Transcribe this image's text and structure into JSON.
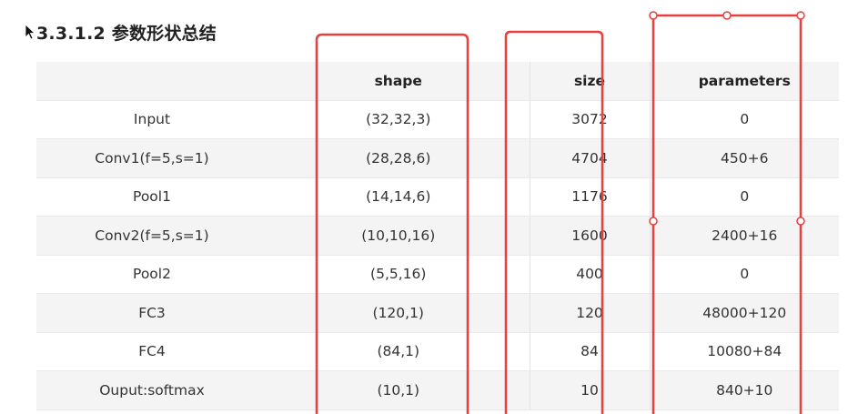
{
  "section": {
    "title": "3.3.1.2 参数形状总结"
  },
  "table": {
    "headers": [
      "",
      "shape",
      "size",
      "parameters"
    ],
    "rows": [
      [
        "Input",
        "(32,32,3)",
        "3072",
        "0"
      ],
      [
        "Conv1(f=5,s=1)",
        "(28,28,6)",
        "4704",
        "450+6"
      ],
      [
        "Pool1",
        "(14,14,6)",
        "1176",
        "0"
      ],
      [
        "Conv2(f=5,s=1)",
        "(10,10,16)",
        "1600",
        "2400+16"
      ],
      [
        "Pool2",
        "(5,5,16)",
        "400",
        "0"
      ],
      [
        "FC3",
        "(120,1)",
        "120",
        "48000+120"
      ],
      [
        "FC4",
        "(84,1)",
        "84",
        "10080+84"
      ],
      [
        "Ouput:softmax",
        "(10,1)",
        "10",
        "840+10"
      ]
    ]
  },
  "annotations": {
    "box_color": "#e8403f",
    "handle_fill": "#ffffff"
  }
}
